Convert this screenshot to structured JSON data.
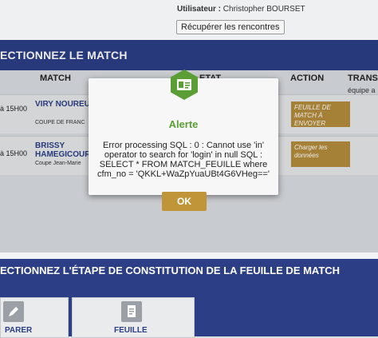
{
  "header": {
    "user_label": "Utilisateur :",
    "user_name": "Christopher BOURSET",
    "fetch_button": "Récupérer les rencontres"
  },
  "section1": {
    "title": "ECTIONNEZ LE MATCH"
  },
  "table": {
    "columns": [
      "MATCH",
      "ETAT",
      "ACTION",
      "TRANS"
    ],
    "trans_sub": "équipe a",
    "rows": [
      {
        "time": "à 15H00",
        "team_line1": "VIRY NOUREU",
        "team_line2": "",
        "competition": "COUPE DE FRANC",
        "action": "FEUILLE DE MATCH À ENVOYER"
      },
      {
        "time": "à 15H00",
        "team_line1": "BRISSY",
        "team_line2": "HAMEGICOUR",
        "competition": "Coupe Jean-Marie",
        "action": "Charger les données"
      }
    ]
  },
  "modal": {
    "title": "Alerte",
    "message": "Error processing SQL : 0 : Cannot use 'in'\noperator to search for 'login' in null SQL :\nSELECT * FROM MATCH_FEUILLE where\ncfm_no = 'QKKL+WaZpYuaUBt4G6VHeg=='",
    "ok_label": "OK",
    "icon": "id-card-icon",
    "icon_color": "#5b9e36",
    "title_color": "#5b9e36",
    "button_color": "#c0953a"
  },
  "section2": {
    "title": "ECTIONNEZ L'ÉTAPE DE CONSTITUTION DE LA FEUILLE DE MATCH"
  },
  "cards": [
    {
      "label": "PARER",
      "icon": "edit-icon"
    },
    {
      "label": "FEUILLE",
      "icon": "sheet-icon"
    }
  ],
  "colors": {
    "brand_blue": "#2c3e86",
    "action_gold": "#b38c3d"
  }
}
